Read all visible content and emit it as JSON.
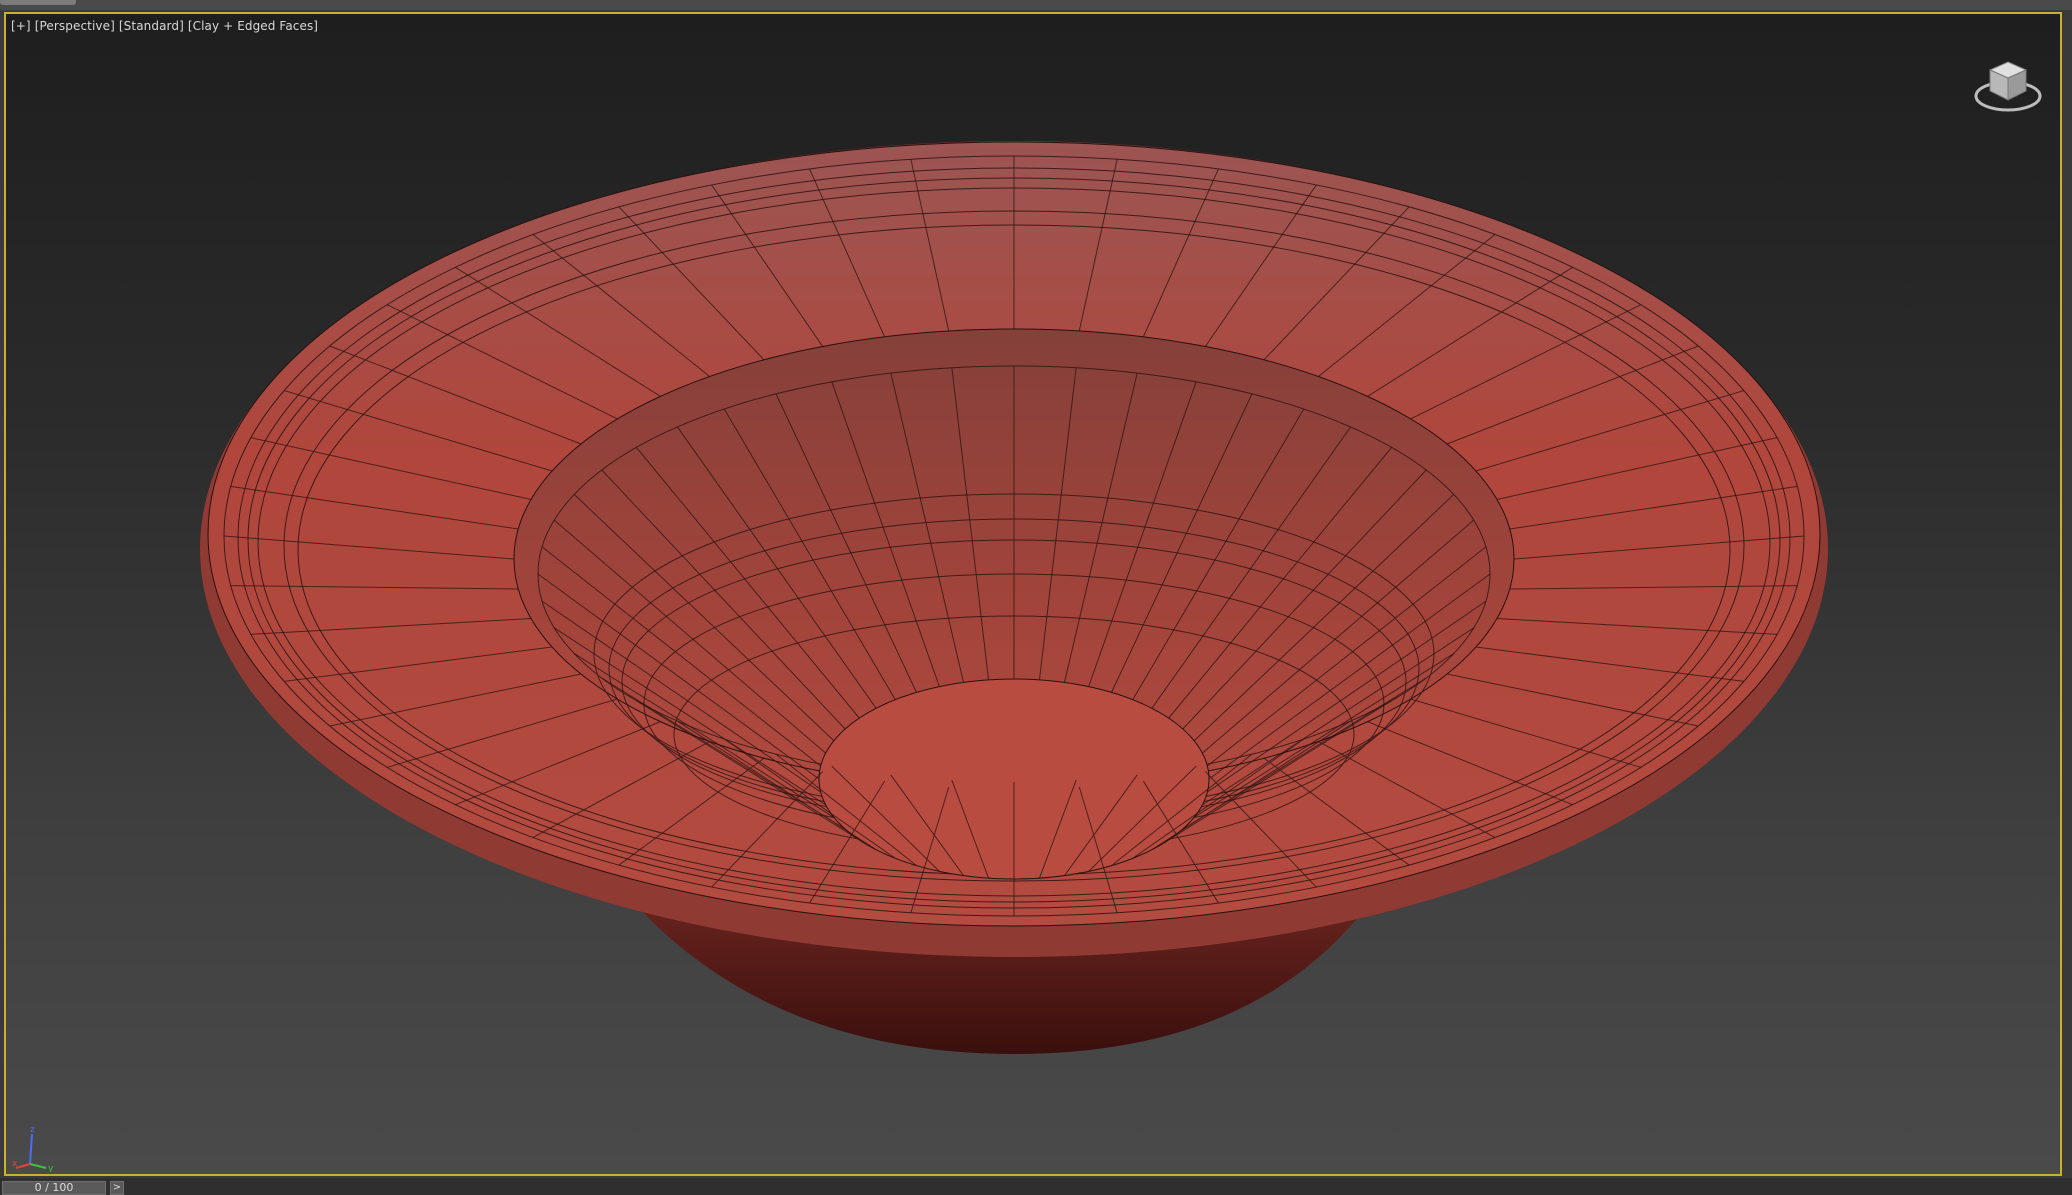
{
  "viewport": {
    "labels": [
      "[+]",
      "[Perspective]",
      "[Standard]",
      "[Clay + Edged Faces]"
    ],
    "object": "bowl mesh",
    "shading_color": "#b84c40",
    "active_border_color": "#c9b030",
    "icons": [
      "viewcube-icon",
      "axis-tripod-icon"
    ],
    "tripod_axes": [
      "x",
      "y",
      "z"
    ]
  },
  "timeline": {
    "frame_display": "0 / 100",
    "next_icon": "chevron-right-icon",
    "next_label": ">"
  }
}
